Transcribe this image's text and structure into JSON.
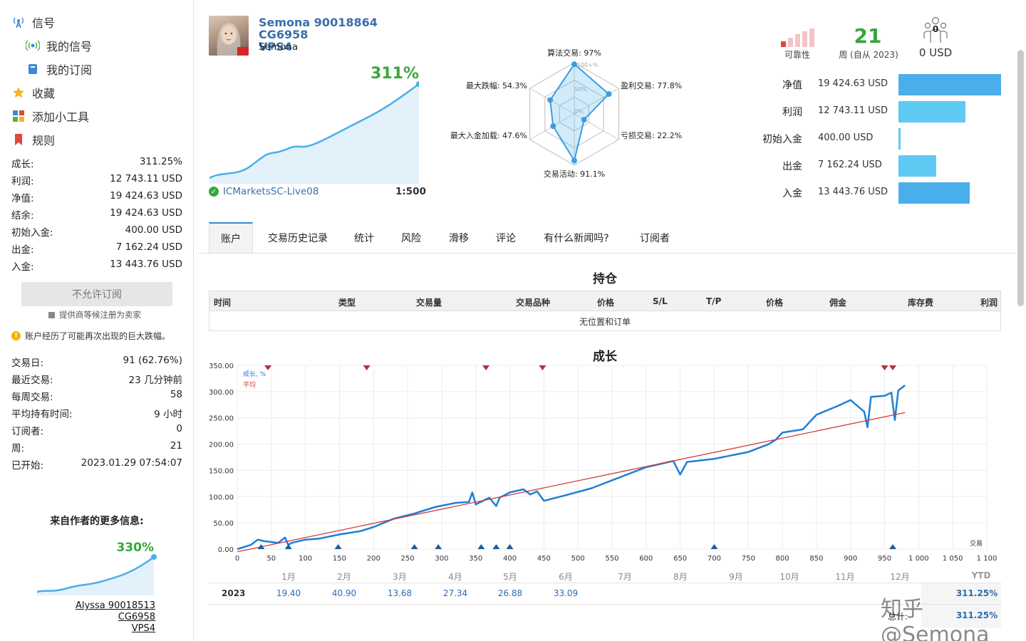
{
  "sidebar": {
    "nav": [
      {
        "label": "信号",
        "icon": "antenna-icon"
      },
      {
        "label": "我的信号",
        "icon": "broadcast-icon"
      },
      {
        "label": "我的订阅",
        "icon": "subscription-icon"
      },
      {
        "label": "收藏",
        "icon": "star-icon"
      },
      {
        "label": "添加小工具",
        "icon": "widget-icon"
      },
      {
        "label": "规则",
        "icon": "bookmark-icon"
      }
    ],
    "stats": [
      {
        "label": "成长:",
        "value": "311.25%"
      },
      {
        "label": "利润:",
        "value": "12 743.11 USD"
      },
      {
        "label": "净值:",
        "value": "19 424.63 USD"
      },
      {
        "label": "结余:",
        "value": "19 424.63 USD"
      },
      {
        "label": "初始入金:",
        "value": "400.00 USD"
      },
      {
        "label": "出金:",
        "value": "7 162.24 USD"
      },
      {
        "label": "入金:",
        "value": "13 443.76 USD"
      }
    ],
    "subscribe_button": "不允许订阅",
    "seller_note": "提供商等候注册为卖家",
    "warning": "账户经历了可能再次出现的巨大跌幅。",
    "stats2": [
      {
        "label": "交易日:",
        "value": "91 (62.76%)"
      },
      {
        "label": "最近交易:",
        "value": "23 几分钟前"
      },
      {
        "label": "每周交易:",
        "value": "58"
      },
      {
        "label": "平均持有时间:",
        "value": "9 小时"
      },
      {
        "label": "订阅者:",
        "value": "0"
      },
      {
        "label": "周:",
        "value": "21"
      },
      {
        "label": "已开始:",
        "value": "2023.01.29 07:54:07"
      }
    ],
    "more_title": "来自作者的更多信息:",
    "more_growth": "330%",
    "more_link_line1": "Alyssa 90018513 CG6958",
    "more_link_line2": "VPS4"
  },
  "header": {
    "title_line1": "Semona 90018864 CG6958",
    "title_line2": "VPS4",
    "author": "Semona",
    "growth": "311%",
    "broker": "ICMarketsSC-Live08",
    "leverage": "1:500",
    "reliability_label": "可靠性",
    "weeks_value": "21",
    "weeks_label": "周 (自从 2023)",
    "subscribers_count": "0",
    "subscribers_value": "0 USD"
  },
  "radar": {
    "labels": [
      "算法交易: 97%",
      "盈利交易: 77.8%",
      "亏损交易: 22.2%",
      "交易活动: 91.1%",
      "最大入金加载: 47.6%",
      "最大跌幅: 54.3%"
    ],
    "values": [
      97,
      77.8,
      22.2,
      91.1,
      47.6,
      54.3
    ],
    "ring_labels": [
      "100+%",
      "50%",
      "0%"
    ]
  },
  "bars": [
    {
      "label": "净值",
      "value": "19 424.63 USD",
      "amount": 19424.63,
      "color": "#4aaeea"
    },
    {
      "label": "利润",
      "value": "12 743.11 USD",
      "amount": 12743.11,
      "color": "#5ec9f2"
    },
    {
      "label": "初始入金",
      "value": "400.00 USD",
      "amount": 400.0,
      "color": "#5ec9f2"
    },
    {
      "label": "出金",
      "value": "7 162.24 USD",
      "amount": 7162.24,
      "color": "#5ec9f2"
    },
    {
      "label": "入金",
      "value": "13 443.76 USD",
      "amount": 13443.76,
      "color": "#4aaeea"
    }
  ],
  "tabs": [
    "账户",
    "交易历史记录",
    "统计",
    "风险",
    "滑移",
    "评论",
    "有什么新闻吗?",
    "订阅者"
  ],
  "positions": {
    "title": "持仓",
    "columns": [
      "时间",
      "类型",
      "交易量",
      "交易品种",
      "价格",
      "S/L",
      "T/P",
      "价格",
      "佣金",
      "库存费",
      "利润"
    ],
    "empty": "无位置和订单"
  },
  "chart_data": {
    "type": "line",
    "title": "成长",
    "xlabel": "交易",
    "ylabel": "",
    "xlim": [
      0,
      1100
    ],
    "ylim": [
      0,
      350
    ],
    "x_ticks": [
      0,
      50,
      100,
      150,
      200,
      250,
      300,
      350,
      400,
      450,
      500,
      550,
      600,
      650,
      700,
      750,
      800,
      850,
      900,
      950,
      1000,
      1050,
      1100
    ],
    "x_tick_labels": [
      "0",
      "50",
      "100",
      "150",
      "200",
      "250",
      "300",
      "350",
      "400",
      "450",
      "500",
      "550",
      "600",
      "650",
      "700",
      "750",
      "800",
      "850",
      "900",
      "950",
      "1 000",
      "1 050",
      "1 100"
    ],
    "y_ticks": [
      0,
      50,
      100,
      150,
      200,
      250,
      300,
      350
    ],
    "y_tick_labels": [
      "0.00",
      "50.00",
      "100.00",
      "150.00",
      "200.00",
      "250.00",
      "300.00",
      "350.00"
    ],
    "grid": true,
    "legend": "top-left",
    "series": [
      {
        "name": "成长, %",
        "color": "#1f7fd8",
        "x": [
          0,
          20,
          30,
          40,
          60,
          70,
          75,
          80,
          100,
          120,
          150,
          180,
          200,
          230,
          260,
          290,
          320,
          340,
          345,
          350,
          370,
          380,
          385,
          400,
          420,
          430,
          440,
          450,
          480,
          520,
          560,
          600,
          640,
          650,
          660,
          700,
          750,
          780,
          790,
          800,
          830,
          850,
          880,
          900,
          920,
          925,
          930,
          950,
          960,
          965,
          970,
          980
        ],
        "values": [
          0,
          8,
          18,
          15,
          12,
          22,
          8,
          12,
          18,
          20,
          28,
          34,
          42,
          58,
          68,
          80,
          88,
          90,
          108,
          85,
          98,
          82,
          98,
          108,
          114,
          104,
          110,
          92,
          102,
          116,
          136,
          156,
          168,
          142,
          166,
          172,
          185,
          200,
          208,
          222,
          228,
          256,
          272,
          284,
          262,
          232,
          290,
          292,
          298,
          246,
          302,
          312
        ]
      },
      {
        "name": "平均",
        "color": "#d23b3b",
        "x": [
          0,
          980
        ],
        "values": [
          -5,
          260
        ]
      }
    ],
    "markers_top": [
      45,
      190,
      365,
      448,
      950,
      962
    ],
    "markers_bottom": [
      35,
      75,
      148,
      260,
      295,
      358,
      380,
      400,
      700,
      962
    ]
  },
  "monthly": {
    "months": [
      "1月",
      "2月",
      "3月",
      "4月",
      "5月",
      "6月",
      "7月",
      "8月",
      "9月",
      "10月",
      "11月",
      "12月"
    ],
    "year": "2023",
    "values": [
      "19.40",
      "40.90",
      "13.68",
      "27.34",
      "26.88",
      "33.09",
      "",
      "",
      "",
      "",
      "",
      ""
    ],
    "ytd_label": "YTD",
    "ytd_value": "311.25%",
    "total_label": "总计:",
    "total_value": "311.25%"
  },
  "watermark": "知乎 @Semona"
}
